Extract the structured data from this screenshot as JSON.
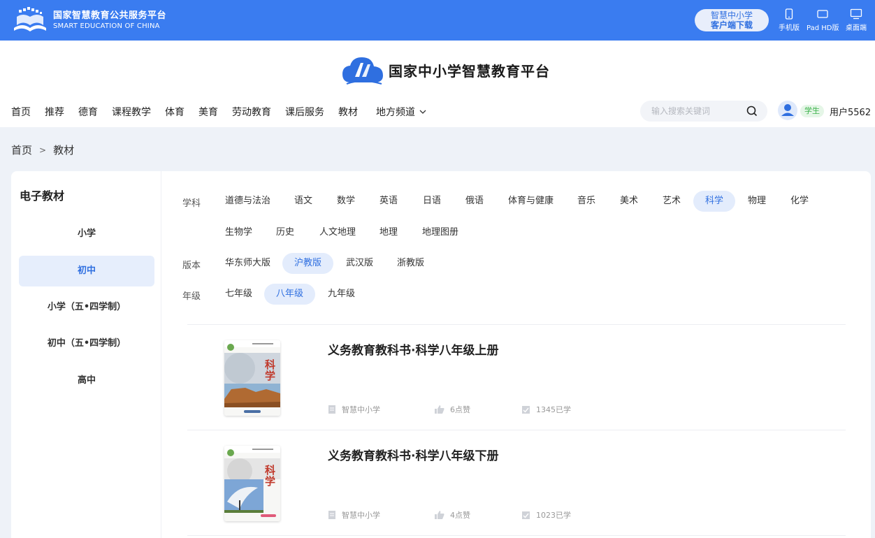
{
  "topbar": {
    "logo_cn": "国家智慧教育公共服务平台",
    "logo_en": "SMART EDUCATION OF CHINA",
    "download_line1": "智慧中小学",
    "download_line2": "客户端下载",
    "devices": [
      {
        "label": "手机版",
        "icon": "phone-icon"
      },
      {
        "label": "Pad HD版",
        "icon": "tablet-icon"
      },
      {
        "label": "桌面端",
        "icon": "desktop-icon"
      }
    ]
  },
  "header": {
    "site_title": "国家中小学智慧教育平台",
    "nav": [
      "首页",
      "推荐",
      "德育",
      "课程教学",
      "体育",
      "美育",
      "劳动教育",
      "课后服务",
      "教材"
    ],
    "nav_dropdown": "地方频道",
    "search_placeholder": "输入搜索关键词",
    "role_badge": "学生",
    "username": "用户5562"
  },
  "breadcrumb": {
    "home": "首页",
    "separator": ">",
    "current": "教材"
  },
  "sidebar": {
    "title": "电子教材",
    "items": [
      "小学",
      "初中",
      "小学（五•四学制）",
      "初中（五•四学制）",
      "高中"
    ],
    "active_index": 1
  },
  "filters": {
    "subject_label": "学科",
    "subjects": [
      "道德与法治",
      "语文",
      "数学",
      "英语",
      "日语",
      "俄语",
      "体育与健康",
      "音乐",
      "美术",
      "艺术",
      "科学",
      "物理",
      "化学",
      "生物学",
      "历史",
      "人文地理",
      "地理",
      "地理图册"
    ],
    "subject_active": "科学",
    "edition_label": "版本",
    "editions": [
      "华东师大版",
      "沪教版",
      "武汉版",
      "浙教版"
    ],
    "edition_active": "沪教版",
    "grade_label": "年级",
    "grades": [
      "七年级",
      "八年级",
      "九年级"
    ],
    "grade_active": "八年级"
  },
  "books": [
    {
      "title": "义务教育教科书·科学八年级上册",
      "cover_char1": "科",
      "cover_char2": "学",
      "publisher": "智慧中小学",
      "likes": "6点赞",
      "learners": "1345已学"
    },
    {
      "title": "义务教育教科书·科学八年级下册",
      "cover_char1": "科",
      "cover_char2": "学",
      "publisher": "智慧中小学",
      "likes": "4点赞",
      "learners": "1023已学"
    }
  ],
  "colors": {
    "brand_blue": "#3a7cf0",
    "active_blue": "#2f6fe0",
    "active_bg": "#e3ecfc",
    "badge_green": "#3bb24a"
  }
}
